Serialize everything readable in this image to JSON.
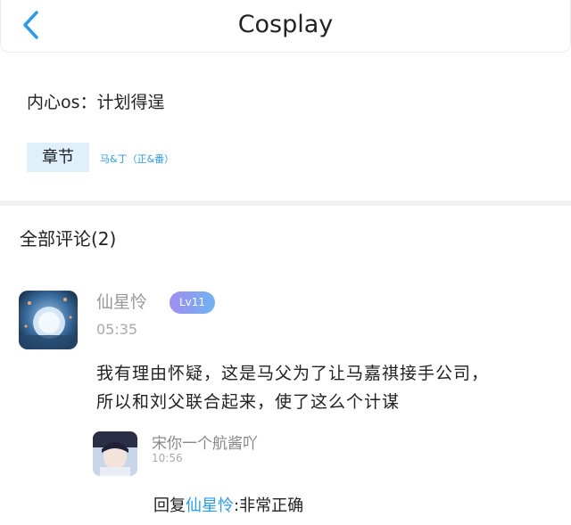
{
  "header": {
    "title": "Cosplay",
    "back_icon": "chevron-left-icon"
  },
  "chapter_info": {
    "note": "内心os：计划得逞",
    "tag_label": "章节",
    "chapter_name": "马&丁（正&番）"
  },
  "comments": {
    "title": "全部评论(2)",
    "main": {
      "username": "仙星怜",
      "level": "Lv11",
      "time": "05:35",
      "lines": [
        "我有理由怀疑，这是马父为了让马嘉祺接手公司，",
        "所以和刘父联合起来，使了这么个计谋"
      ]
    },
    "reply": {
      "username": "宋你一个航酱吖",
      "time": "10:56",
      "prefix": "回复",
      "mention": "仙星怜",
      "text": ":非常正确"
    }
  },
  "colors": {
    "accent": "#2e9be8",
    "tag_bg": "#dff0fb"
  }
}
